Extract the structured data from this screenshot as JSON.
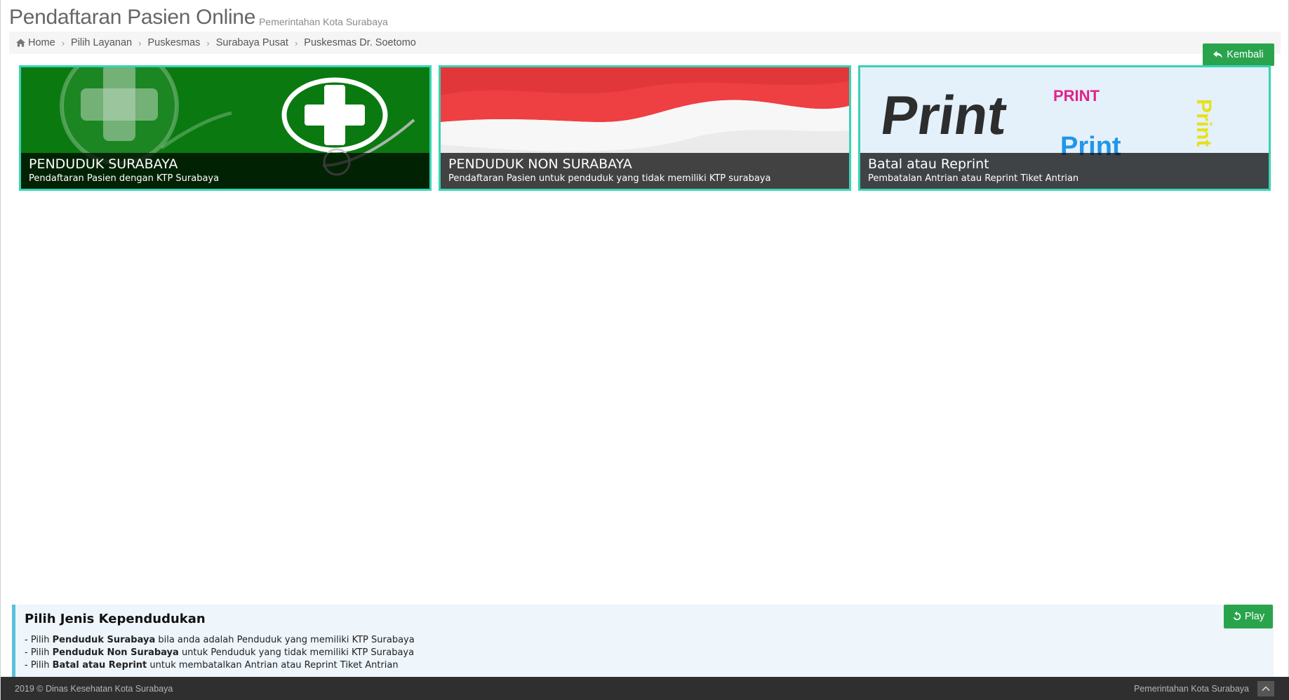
{
  "header": {
    "title": "Pendaftaran Pasien Online",
    "subtitle": "Pemerintahan Kota Surabaya"
  },
  "breadcrumb": {
    "items": [
      "Home",
      "Pilih Layanan",
      "Puskesmas",
      "Surabaya Pusat",
      "Puskesmas Dr. Soetomo"
    ]
  },
  "back_button": {
    "label": "Kembali",
    "icon": "reply-icon"
  },
  "cards": [
    {
      "title": "PENDUDUK SURABAYA",
      "description": "Pendaftaran Pasien dengan KTP Surabaya",
      "image": "green-medical-cross-image"
    },
    {
      "title": "PENDUDUK NON SURABAYA",
      "description": "Pendaftaran Pasien untuk penduduk yang tidak memiliki KTP surabaya",
      "image": "indonesian-flag-image"
    },
    {
      "title": "Batal atau Reprint",
      "description": "Pembatalan Antrian atau Reprint Tiket Antrian",
      "image": "print-text-3d-image",
      "image_words": [
        "Print",
        "PRINT",
        "Print",
        "Print"
      ]
    }
  ],
  "info": {
    "title": "Pilih Jenis Kependudukan",
    "lines": [
      {
        "prefix": "- Pilih ",
        "bold": "Penduduk Surabaya",
        "suffix": " bila anda adalah Penduduk yang memiliki KTP Surabaya"
      },
      {
        "prefix": "- Pilih ",
        "bold": "Penduduk Non Surabaya",
        "suffix": " untuk Penduduk yang tidak memiliki KTP Surabaya"
      },
      {
        "prefix": "- Pilih ",
        "bold": "Batal atau Reprint",
        "suffix": " untuk membatalkan Antrian atau Reprint Tiket Antrian"
      }
    ]
  },
  "play_button": {
    "label": "Play",
    "icon": "replay-icon"
  },
  "footer": {
    "left": "2019 © Dinas Kesehatan Kota Surabaya",
    "right": "Pemerintahan Kota Surabaya"
  },
  "colors": {
    "accent_green": "#2aa44c",
    "card_border": "#39d3b4",
    "info_border": "#5bc0de",
    "footer_bg": "#2f2f2f"
  }
}
